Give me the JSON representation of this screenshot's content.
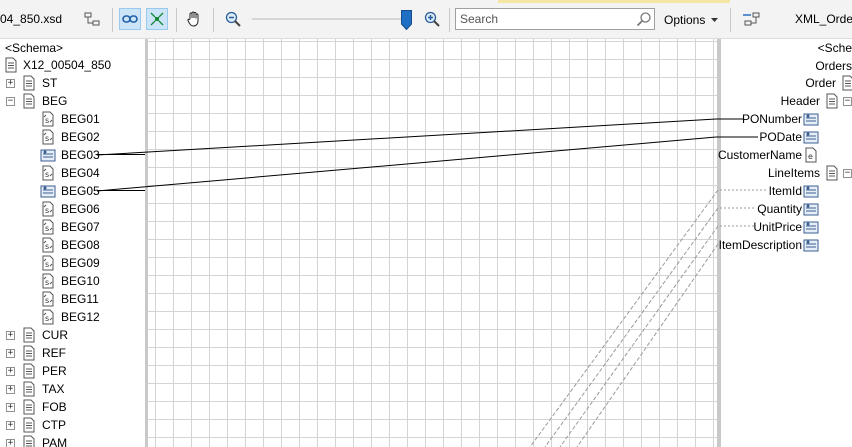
{
  "toolbar": {
    "source_file": "04_850.xsd",
    "destination_file": "XML_Order",
    "search_placeholder": "Search",
    "options_label": "Options"
  },
  "source_tree": {
    "schema_label": "<Schema>",
    "root": "X12_00504_850",
    "nodes": [
      {
        "label": "ST",
        "type": "record",
        "expander": "+"
      },
      {
        "label": "BEG",
        "type": "record",
        "expander": "-"
      },
      {
        "label": "BEG01",
        "type": "field",
        "linked": false
      },
      {
        "label": "BEG02",
        "type": "field",
        "linked": false
      },
      {
        "label": "BEG03",
        "type": "field",
        "linked": true
      },
      {
        "label": "BEG04",
        "type": "field",
        "linked": false
      },
      {
        "label": "BEG05",
        "type": "field",
        "linked": true
      },
      {
        "label": "BEG06",
        "type": "field",
        "linked": false
      },
      {
        "label": "BEG07",
        "type": "field",
        "linked": false
      },
      {
        "label": "BEG08",
        "type": "field",
        "linked": false
      },
      {
        "label": "BEG09",
        "type": "field",
        "linked": false
      },
      {
        "label": "BEG10",
        "type": "field",
        "linked": false
      },
      {
        "label": "BEG11",
        "type": "field",
        "linked": false
      },
      {
        "label": "BEG12",
        "type": "field",
        "linked": false
      },
      {
        "label": "CUR",
        "type": "record",
        "expander": "+"
      },
      {
        "label": "REF",
        "type": "record",
        "expander": "+"
      },
      {
        "label": "PER",
        "type": "record",
        "expander": "+"
      },
      {
        "label": "TAX",
        "type": "record",
        "expander": "+"
      },
      {
        "label": "FOB",
        "type": "record",
        "expander": "+"
      },
      {
        "label": "CTP",
        "type": "record",
        "expander": "+"
      },
      {
        "label": "PAM",
        "type": "record",
        "expander": "+"
      }
    ]
  },
  "destination_tree": {
    "schema_label": "<Sche",
    "root": "Orders",
    "nodes": [
      {
        "label": "Order",
        "type": "record"
      },
      {
        "label": "Header",
        "type": "record"
      },
      {
        "label": "PONumber",
        "type": "field",
        "linked": true
      },
      {
        "label": "PODate",
        "type": "field",
        "linked": true
      },
      {
        "label": "CustomerName",
        "type": "field",
        "linked": false
      },
      {
        "label": "LineItems",
        "type": "record"
      },
      {
        "label": "ItemId",
        "type": "field",
        "linked": true
      },
      {
        "label": "Quantity",
        "type": "field",
        "linked": true
      },
      {
        "label": "UnitPrice",
        "type": "field",
        "linked": true
      },
      {
        "label": "ItemDescription",
        "type": "field",
        "linked": true
      }
    ]
  },
  "colors": {
    "grid_line": "#d4d4d4",
    "link_solid": "#000000",
    "link_dashed": "#9a9a9a",
    "pressed_button": "#cce4f7"
  }
}
